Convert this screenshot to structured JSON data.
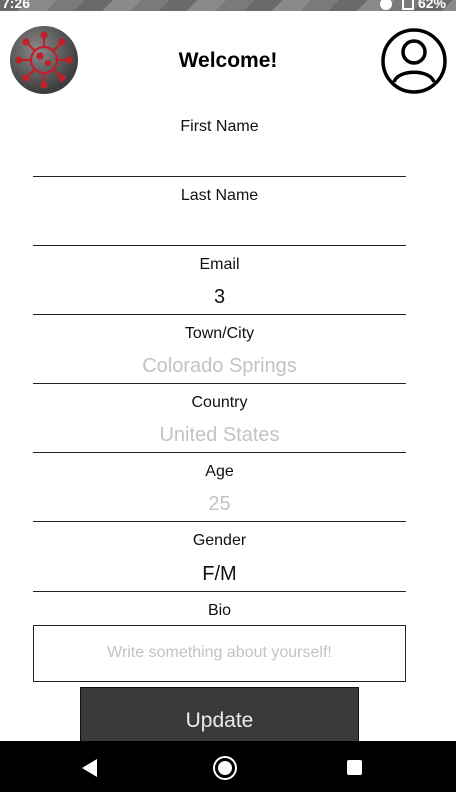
{
  "status_bar": {
    "time": "7:26",
    "battery": "62%"
  },
  "header": {
    "title": "Welcome!",
    "logo_icon": "virus-icon",
    "profile_icon": "user-account-icon"
  },
  "form": {
    "first_name": {
      "label": "First Name",
      "value": ""
    },
    "last_name": {
      "label": "Last Name",
      "value": ""
    },
    "email": {
      "label": "Email",
      "value": "3"
    },
    "town_city": {
      "label": "Town/City",
      "placeholder": "Colorado Springs"
    },
    "country": {
      "label": "Country",
      "placeholder": "United States"
    },
    "age": {
      "label": "Age",
      "placeholder": "25"
    },
    "gender": {
      "label": "Gender",
      "value": "F/M"
    },
    "bio": {
      "label": "Bio",
      "placeholder": "Write something about yourself!"
    }
  },
  "update_button": {
    "label": "Update"
  },
  "nav_bar": {
    "back_icon": "back-triangle-icon",
    "home_icon": "home-circle-icon",
    "recent_icon": "recent-apps-square-icon"
  },
  "colors": {
    "button_bg": "#3a3a3a",
    "hint_text": "#c3c3c3",
    "nav_bg": "#000000"
  }
}
